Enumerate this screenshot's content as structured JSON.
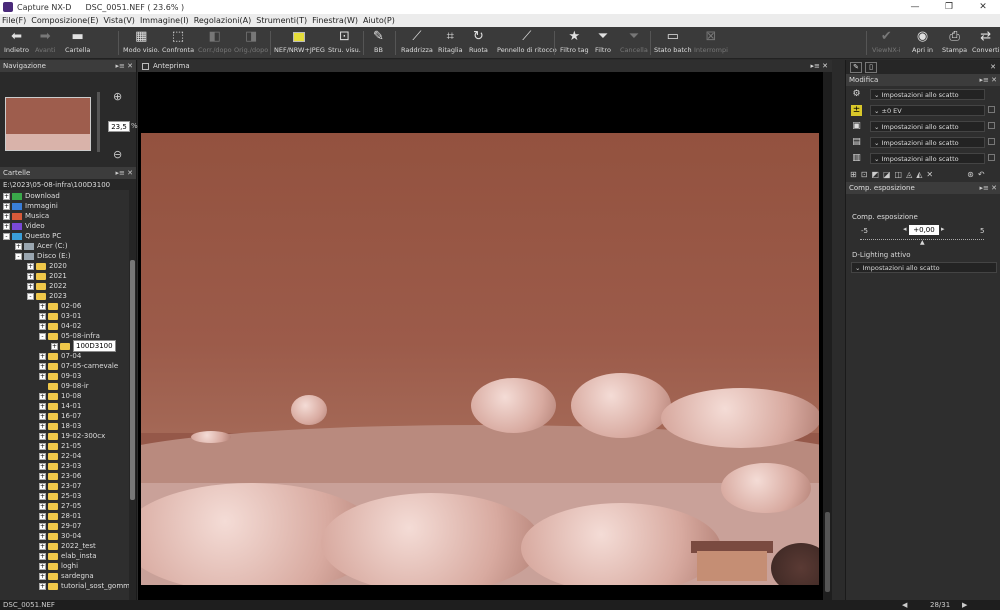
{
  "window": {
    "app_title": "Capture NX-D",
    "doc_title": "DSC_0051.NEF ( 23.6% )",
    "controls": [
      "—",
      "❐",
      "✕"
    ]
  },
  "menu": [
    "File(F)",
    "Composizione(E)",
    "Vista(V)",
    "Immagine(I)",
    "Regolazioni(A)",
    "Strumenti(T)",
    "Finestra(W)",
    "Aiuto(P)"
  ],
  "toolbar": {
    "back": "Indietro",
    "forward": "Avanti",
    "folder": "Cartella",
    "view_mode": "Modo visio.",
    "compare": "Confronta",
    "corr_orig": "Corr./dopo",
    "orig_after": "Orig./dopo",
    "nef_jpeg": "NEF/NRW+JPEG",
    "view_tools": "Stru. visu.",
    "wb": "BB",
    "straighten": "Raddrizza",
    "crop": "Ritaglia",
    "rotate": "Ruota",
    "retouch": "Pennello di ritocco",
    "filter_tag": "Filtro tag",
    "filter": "Filtro",
    "delete": "Cancella",
    "batch": "Stato batch",
    "interrupt": "Interrompi",
    "viewnx": "ViewNX-i",
    "open_in": "Apri in",
    "print": "Stampa",
    "convert": "Converti"
  },
  "navigation": {
    "title": "Navigazione",
    "zoom_value": "23,5",
    "zoom_unit": "%"
  },
  "folders": {
    "title": "Cartelle",
    "path": "E:\\2023\\05-08-infra\\100D3100",
    "tree": [
      {
        "label": "Download",
        "indent": 0,
        "exp": "+",
        "type": "dl"
      },
      {
        "label": "Immagini",
        "indent": 0,
        "exp": "+",
        "type": "img"
      },
      {
        "label": "Musica",
        "indent": 0,
        "exp": "+",
        "type": "mus"
      },
      {
        "label": "Video",
        "indent": 0,
        "exp": "+",
        "type": "vid"
      },
      {
        "label": "Questo PC",
        "indent": 0,
        "exp": "-",
        "type": "pc"
      },
      {
        "label": "Acer (C:)",
        "indent": 1,
        "exp": "+",
        "type": "drive"
      },
      {
        "label": "Disco (E:)",
        "indent": 1,
        "exp": "-",
        "type": "drive"
      },
      {
        "label": "2020",
        "indent": 2,
        "exp": "+",
        "type": "folder"
      },
      {
        "label": "2021",
        "indent": 2,
        "exp": "+",
        "type": "folder"
      },
      {
        "label": "2022",
        "indent": 2,
        "exp": "+",
        "type": "folder"
      },
      {
        "label": "2023",
        "indent": 2,
        "exp": "-",
        "type": "folder"
      },
      {
        "label": "02-06",
        "indent": 3,
        "exp": "+",
        "type": "folder"
      },
      {
        "label": "03-01",
        "indent": 3,
        "exp": "+",
        "type": "folder"
      },
      {
        "label": "04-02",
        "indent": 3,
        "exp": "+",
        "type": "folder"
      },
      {
        "label": "05-08-infra",
        "indent": 3,
        "exp": "-",
        "type": "folder"
      },
      {
        "label": "100D3100",
        "indent": 4,
        "exp": "+",
        "type": "folder",
        "selected": true
      },
      {
        "label": "07-04",
        "indent": 3,
        "exp": "+",
        "type": "folder"
      },
      {
        "label": "07-05-carnevale",
        "indent": 3,
        "exp": "+",
        "type": "folder"
      },
      {
        "label": "09-03",
        "indent": 3,
        "exp": "+",
        "type": "folder"
      },
      {
        "label": "09-08-ir",
        "indent": 3,
        "exp": "",
        "type": "folder"
      },
      {
        "label": "10-08",
        "indent": 3,
        "exp": "+",
        "type": "folder"
      },
      {
        "label": "14-01",
        "indent": 3,
        "exp": "+",
        "type": "folder"
      },
      {
        "label": "16-07",
        "indent": 3,
        "exp": "+",
        "type": "folder"
      },
      {
        "label": "18-03",
        "indent": 3,
        "exp": "+",
        "type": "folder"
      },
      {
        "label": "19-02-300cx",
        "indent": 3,
        "exp": "+",
        "type": "folder"
      },
      {
        "label": "21-05",
        "indent": 3,
        "exp": "+",
        "type": "folder"
      },
      {
        "label": "22-04",
        "indent": 3,
        "exp": "+",
        "type": "folder"
      },
      {
        "label": "23-03",
        "indent": 3,
        "exp": "+",
        "type": "folder"
      },
      {
        "label": "23-06",
        "indent": 3,
        "exp": "+",
        "type": "folder"
      },
      {
        "label": "23-07",
        "indent": 3,
        "exp": "+",
        "type": "folder"
      },
      {
        "label": "25-03",
        "indent": 3,
        "exp": "+",
        "type": "folder"
      },
      {
        "label": "27-05",
        "indent": 3,
        "exp": "+",
        "type": "folder"
      },
      {
        "label": "28-01",
        "indent": 3,
        "exp": "+",
        "type": "folder"
      },
      {
        "label": "29-07",
        "indent": 3,
        "exp": "+",
        "type": "folder"
      },
      {
        "label": "30-04",
        "indent": 3,
        "exp": "+",
        "type": "folder"
      },
      {
        "label": "2022_test",
        "indent": 3,
        "exp": "+",
        "type": "folder"
      },
      {
        "label": "elab_insta",
        "indent": 3,
        "exp": "+",
        "type": "folder"
      },
      {
        "label": "loghi",
        "indent": 3,
        "exp": "+",
        "type": "folder"
      },
      {
        "label": "sardegna",
        "indent": 3,
        "exp": "+",
        "type": "folder"
      },
      {
        "label": "tutorial_sost_gomma",
        "indent": 3,
        "exp": "+",
        "type": "folder"
      }
    ]
  },
  "preview": {
    "title": "Anteprima"
  },
  "edit": {
    "title": "Modifica",
    "rows": [
      {
        "icon": "gear-icon",
        "value": "Impostazioni allo scatto"
      },
      {
        "icon": "exposure-icon",
        "value": "±0 EV"
      },
      {
        "icon": "wb-icon",
        "value": "Impostazioni allo scatto"
      },
      {
        "icon": "picture-control-icon",
        "value": "Impostazioni allo scatto"
      },
      {
        "icon": "dlighting-icon",
        "value": "Impostazioni allo scatto"
      }
    ]
  },
  "exposure": {
    "title": "Comp. esposizione",
    "label": "Comp. esposizione",
    "value": "+0,00",
    "min": "-5",
    "zero": "0",
    "max": "5",
    "dlighting_label": "D-Lighting attivo",
    "dlighting_value": "Impostazioni allo scatto"
  },
  "status": {
    "filename": "DSC_0051.NEF",
    "count": "28/31"
  },
  "colors": {
    "folder": "#f0c84a",
    "accent_yellow": "#e4dc3a",
    "photo_sky": "#955849"
  }
}
